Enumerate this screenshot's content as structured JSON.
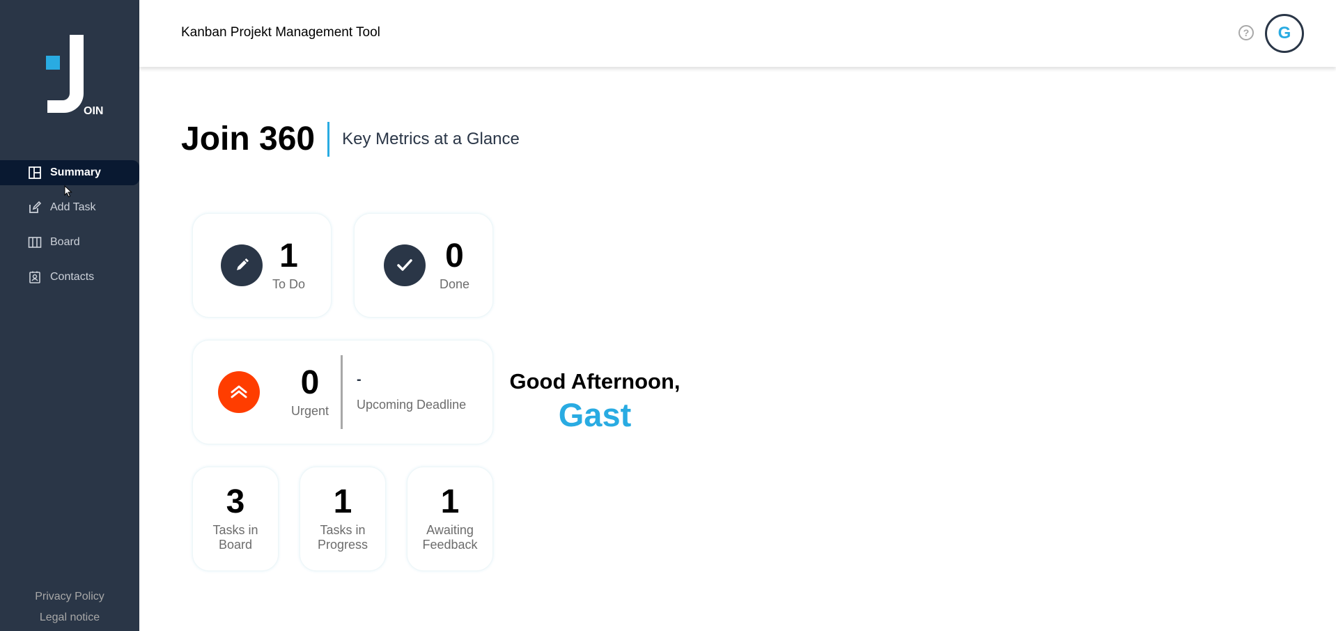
{
  "app": {
    "title": "Kanban Projekt Management Tool",
    "logo_text": "OIN",
    "accent_color": "#29abe2",
    "sidebar_color": "#2a3647"
  },
  "header": {
    "help_icon": "?",
    "avatar_initial": "G"
  },
  "sidebar": {
    "items": [
      {
        "label": "Summary",
        "icon": "summary-icon",
        "active": true
      },
      {
        "label": "Add Task",
        "icon": "edit-icon",
        "active": false
      },
      {
        "label": "Board",
        "icon": "board-icon",
        "active": false
      },
      {
        "label": "Contacts",
        "icon": "contacts-icon",
        "active": false
      }
    ],
    "footer": {
      "privacy": "Privacy Policy",
      "legal": "Legal notice"
    }
  },
  "page": {
    "title": "Join 360",
    "subtitle": "Key Metrics at a Glance"
  },
  "metrics": {
    "todo": {
      "value": "1",
      "label": "To Do"
    },
    "done": {
      "value": "0",
      "label": "Done"
    },
    "urgent": {
      "value": "0",
      "label": "Urgent",
      "color": "#ff3d00"
    },
    "deadline": {
      "date": "-",
      "label": "Upcoming Deadline"
    },
    "board": {
      "value": "3",
      "label_line1": "Tasks in",
      "label_line2": "Board"
    },
    "progress": {
      "value": "1",
      "label_line1": "Tasks in",
      "label_line2": "Progress"
    },
    "feedback": {
      "value": "1",
      "label_line1": "Awaiting",
      "label_line2": "Feedback"
    }
  },
  "greeting": {
    "text": "Good Afternoon,",
    "name": "Gast"
  }
}
